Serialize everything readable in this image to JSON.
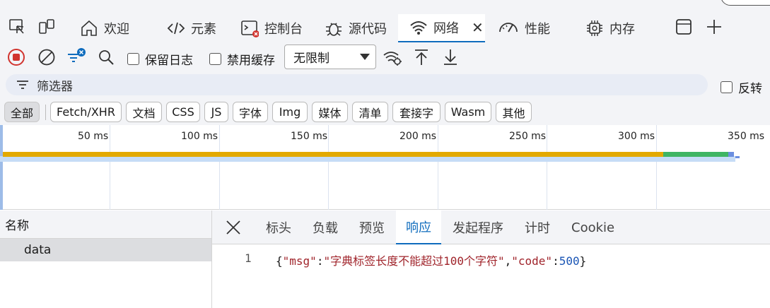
{
  "tabs": [
    {
      "label": "欢迎",
      "icon": "home-icon"
    },
    {
      "label": "元素",
      "icon": "code-icon"
    },
    {
      "label": "控制台",
      "icon": "console-icon"
    },
    {
      "label": "源代码",
      "icon": "bug-icon"
    },
    {
      "label": "网络",
      "icon": "wifi-icon",
      "active": true
    },
    {
      "label": "性能",
      "icon": "gauge-icon"
    },
    {
      "label": "内存",
      "icon": "chip-icon"
    }
  ],
  "toolbar": {
    "preserve_log": "保留日志",
    "disable_cache": "禁用缓存",
    "throttle_value": "无限制"
  },
  "filter": {
    "placeholder": "筛选器",
    "invert": "反转"
  },
  "types": [
    "全部",
    "Fetch/XHR",
    "文档",
    "CSS",
    "JS",
    "字体",
    "Img",
    "媒体",
    "清单",
    "套接字",
    "Wasm",
    "其他"
  ],
  "overview": {
    "ticks": [
      "50 ms",
      "100 ms",
      "150 ms",
      "200 ms",
      "250 ms",
      "300 ms",
      "350 ms"
    ],
    "waiting_color": "#e3a900",
    "download_color": "#3fb563"
  },
  "requests": {
    "column_name": "名称",
    "rows": [
      "data"
    ]
  },
  "detail_tabs": [
    "标头",
    "负载",
    "预览",
    "响应",
    "发起程序",
    "计时",
    "Cookie"
  ],
  "active_detail_tab": "响应",
  "response": {
    "line_number": "1",
    "open_brace": "{",
    "key1": "\"msg\"",
    "colon": ":",
    "val1": "\"字典标签长度不能超过100个字符\"",
    "comma": ",",
    "key2": "\"code\"",
    "val2": "500",
    "close_brace": "}"
  },
  "colors": {
    "accent": "#0f6cbd",
    "record_red": "#d1342f"
  }
}
